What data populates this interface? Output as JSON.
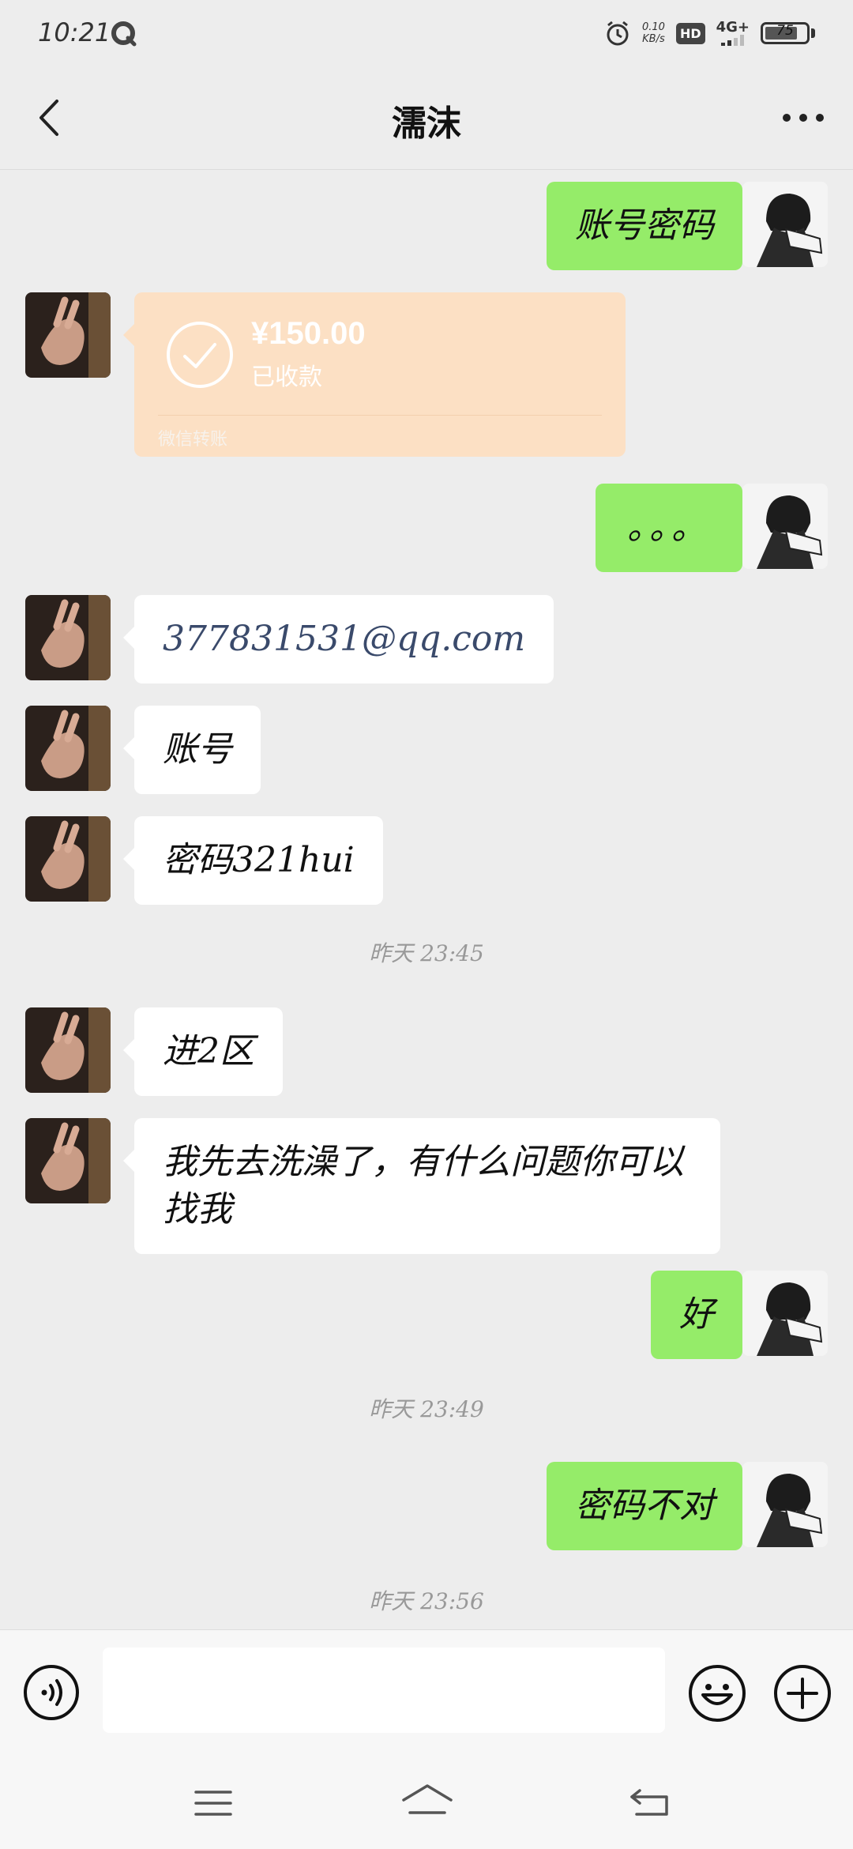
{
  "status_bar": {
    "time": "10:21",
    "net_speed_value": "0.10",
    "net_speed_unit": "KB/s",
    "hd_label": "HD",
    "network_label": "4G+",
    "battery_level": "75"
  },
  "header": {
    "title": "濡沫"
  },
  "messages": {
    "m1": "账号密码",
    "transfer": {
      "amount": "¥150.00",
      "status": "已收款",
      "footer": "微信转账"
    },
    "m3": "。。。",
    "m4": "377831531@qq.com",
    "m5": "账号",
    "m6": "密码321hui",
    "time1": "昨天 23:45",
    "m7": "进2区",
    "m8": "我先去洗澡了，有什么问题你可以找我",
    "m9": "好",
    "time2": "昨天 23:49",
    "m10": "密码不对",
    "time3": "昨天 23:56"
  },
  "input": {
    "value": ""
  }
}
